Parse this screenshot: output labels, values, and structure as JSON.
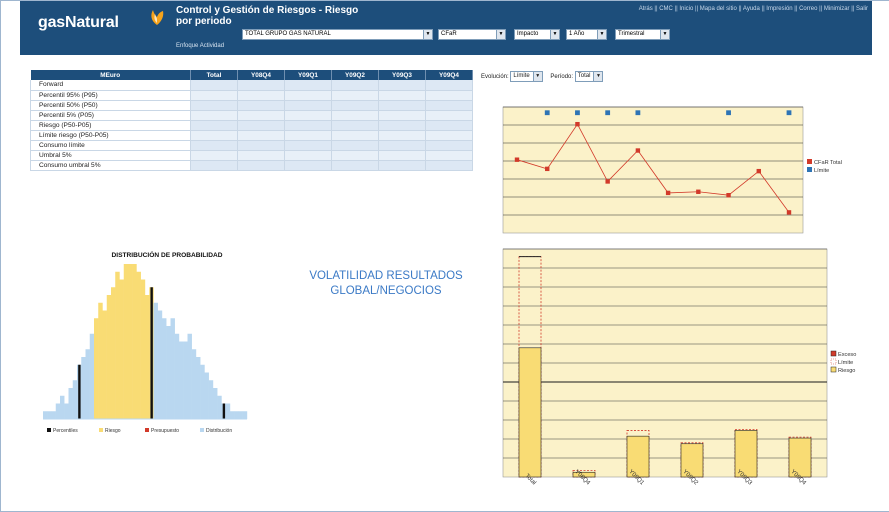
{
  "header": {
    "logo": "gasNatural",
    "title_line1": "Control y Gestión de Riesgos - Riesgo",
    "title_line2": "por periodo",
    "subnav": "Enfoque Actividad",
    "topnav": "Atrás || CMC || Inicio || Mapa del sitio || Ayuda || Impresión || Correo || Minimizar || Salir",
    "selects": {
      "group": "TOTAL GRUPO GAS NATURAL",
      "measure": "CFaR",
      "type": "Impacto",
      "horizon": "1 Año",
      "frequency": "Trimestral"
    }
  },
  "table": {
    "columns": [
      "MEuro",
      "Total",
      "Y08Q4",
      "Y09Q1",
      "Y09Q2",
      "Y09Q3",
      "Y09Q4"
    ],
    "rows": [
      "Forward",
      "Percentil 95% (P95)",
      "Percentil 50% (P50)",
      "Percentil 5% (P05)",
      "Riesgo (P50-P05)",
      "Límite riesgo (P50-P05)",
      "Consumo límite",
      "Umbral 5%",
      "Consumo umbral 5%"
    ]
  },
  "evolution": {
    "label": "Evolución:",
    "value": "Límite",
    "period_label": "Período:",
    "period_value": "Total"
  },
  "colors": {
    "header_bg": "#1d4e7b",
    "chart_bg": "#fbf2c9",
    "series_red": "#d23a2a",
    "series_blue": "#2e74b5",
    "bar_yellow": "#f9dc74",
    "dist_blue": "#b9d7f0"
  },
  "line_chart": {
    "legend": [
      "CFaR Total",
      "Límite"
    ],
    "chart_data": {
      "type": "line",
      "series": [
        {
          "name": "CFaR Total",
          "values": [
            6.4,
            5.6,
            9.5,
            4.5,
            7.2,
            3.5,
            3.6,
            3.3,
            5.4,
            1.8
          ]
        },
        {
          "name": "Límite",
          "values": [
            null,
            10.5,
            10.5,
            10.5,
            10.5,
            null,
            null,
            10.5,
            null,
            10.5
          ]
        }
      ],
      "ylim": [
        0,
        11
      ]
    }
  },
  "distribution": {
    "title": "DISTRIBUCIÓN DE PROBABILIDAD",
    "legend": [
      "Percentiles",
      "Riesgo",
      "Presupuesto",
      "Distribución"
    ],
    "chart_data": {
      "type": "bar",
      "values": [
        1,
        1,
        1,
        2,
        3,
        2,
        4,
        5,
        7,
        8,
        9,
        11,
        13,
        15,
        14,
        16,
        17,
        19,
        18,
        20,
        20,
        20,
        19,
        18,
        16,
        17,
        15,
        14,
        13,
        12,
        13,
        11,
        10,
        10,
        11,
        9,
        8,
        7,
        6,
        5,
        4,
        3,
        2,
        2,
        1,
        1,
        1,
        1
      ],
      "risk_range": [
        12,
        25
      ],
      "percentile_bins": [
        8,
        25,
        42
      ]
    }
  },
  "volatility": {
    "line1": "VOLATILIDAD RESULTADOS",
    "line2": "GLOBAL/NEGOCIOS"
  },
  "bar_chart": {
    "legend": [
      "Exceso",
      "Límite",
      "Riesgo"
    ],
    "chart_data": {
      "type": "bar",
      "categories": [
        "Total",
        "Y08Q4",
        "Y09Q1",
        "Y09Q2",
        "Y09Q3",
        "Y09Q4"
      ],
      "series": [
        {
          "name": "Riesgo",
          "values": [
            13.6,
            0.5,
            4.3,
            3.5,
            4.9,
            4.1
          ]
        },
        {
          "name": "Límite",
          "values": [
            23.2,
            0.7,
            4.9,
            3.6,
            5.0,
            4.2
          ]
        }
      ],
      "ylim": [
        0,
        24
      ]
    }
  }
}
